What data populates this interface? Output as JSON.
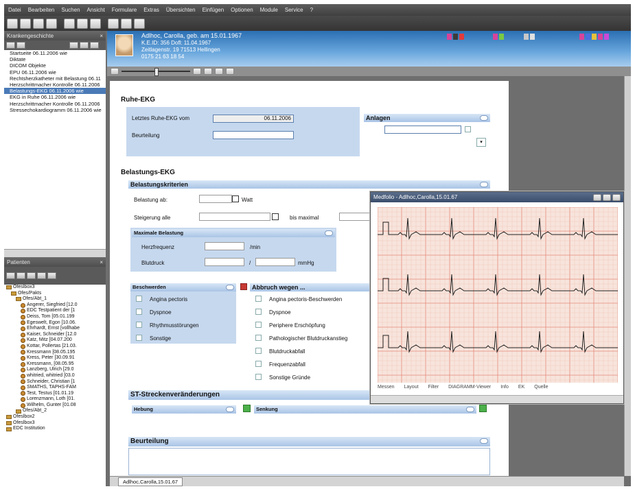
{
  "menu": [
    "Datei",
    "Bearbeiten",
    "Suchen",
    "Ansicht",
    "Formulare",
    "Extras",
    "Übersichten",
    "Einfügen",
    "Optionen",
    "Module",
    "Service",
    "?"
  ],
  "left_top": {
    "title": "Krankengeschichte",
    "items": [
      "Startseite 06.11.2006 wie",
      "Diktate",
      "DICOM Objekte",
      "EPU 06.11.2006 wie",
      "Rechtsherzkatheter mit Belastung 06.11",
      "Herzschrittmacher Kontrolle 06.11.2006",
      "Belastungs-EKG 06.11.2006 wie",
      "EKG in Ruhe 06.11.2006 wie",
      "Herzschrittmacher Kontrolle 06.11.2006",
      "Stressechokardiogramm 06.11.2006 wie"
    ],
    "selected_index": 6
  },
  "left_bottom": {
    "title": "Patienten",
    "tree": [
      {
        "label": "Ofeslbox3",
        "kind": "folder",
        "indent": 0
      },
      {
        "label": "Ofes/Pakts",
        "kind": "folder",
        "indent": 1
      },
      {
        "label": "Ofes/Abt_1",
        "kind": "folder",
        "indent": 2
      },
      {
        "label": "Angerer, Siegfried [12.0",
        "kind": "person",
        "indent": 3
      },
      {
        "label": "EDC Testpatient der [1",
        "kind": "person",
        "indent": 3
      },
      {
        "label": "Deiss, Tom [05.01.199",
        "kind": "person",
        "indent": 3
      },
      {
        "label": "Egeswelt, Egon [10.06.",
        "kind": "person",
        "indent": 3
      },
      {
        "label": "Ehrhardt, Ernst [vollhabe",
        "kind": "person",
        "indent": 3
      },
      {
        "label": "Kaiser, Schneider [12.0",
        "kind": "person",
        "indent": 3
      },
      {
        "label": "Katz, Mitz [04.07.200",
        "kind": "person",
        "indent": 3
      },
      {
        "label": "Kottar, Pollertas [21.03.",
        "kind": "person",
        "indent": 3
      },
      {
        "label": "Kressmann [08.05.195",
        "kind": "person",
        "indent": 3
      },
      {
        "label": "Kress, Peter [30.09.91",
        "kind": "person",
        "indent": 3
      },
      {
        "label": "Kressmann, [08.05.95",
        "kind": "person",
        "indent": 3
      },
      {
        "label": "Lanzberg, Ulrich [29.0",
        "kind": "person",
        "indent": 3
      },
      {
        "label": "whitried, whitried [03.0",
        "kind": "person",
        "indent": 3
      },
      {
        "label": "Schneider, Christian [1",
        "kind": "person",
        "indent": 3
      },
      {
        "label": "SMATHS, TAPHS-FAM",
        "kind": "person",
        "indent": 3
      },
      {
        "label": "Test, Testus [01.01.19",
        "kind": "person",
        "indent": 3
      },
      {
        "label": "Lorenzmann, Loth [01.",
        "kind": "person",
        "indent": 3
      },
      {
        "label": "Wilhelm, Gunter [01.08",
        "kind": "person",
        "indent": 3
      },
      {
        "label": "Ofes/Abt_2",
        "kind": "folder",
        "indent": 2
      },
      {
        "label": "Ofeslbox2",
        "kind": "folder",
        "indent": 0
      },
      {
        "label": "Ofeslbox3",
        "kind": "folder",
        "indent": 0
      },
      {
        "label": "EDC Institution",
        "kind": "folder",
        "indent": 0
      }
    ]
  },
  "patient": {
    "name": "Adlhoc, Carolla, geb. am 15.01.1967",
    "line1": "K.E.ID: 356 Dofl: 11.04.1967",
    "line2": "Zeitlagenstr. 19 71513 Hellingen",
    "line3": "0175 21 63 18 54"
  },
  "swatch_colors": [
    "#d8439a",
    "#3b3b3b",
    "#e23a3a",
    "#d8439a",
    "#7ac943",
    "#c8c8c8",
    "#e0e0e0",
    "#d8439a",
    "#4a6fe0",
    "#e8c23a",
    "#d8439a",
    "#c84ad8"
  ],
  "doc": {
    "ruhe_title": "Ruhe-EKG",
    "letztes_label": "Letztes Ruhe-EKG vom",
    "letztes_value": "06.11.2006",
    "beurteilung_label": "Beurteilung",
    "anlagen": "Anlagen",
    "belastung_title": "Belastungs-EKG",
    "kriterien_bar": "Belastungskriterien",
    "belastung_ab": "Belastung ab:",
    "watt": "Watt",
    "steigerung": "Steigerung alle",
    "bis_maximal": "bis maximal",
    "maximale_bar": "Maximale Belastung",
    "herzfrequenz": "Herzfrequenz",
    "hf_unit": "/min",
    "blutdruck": "Blutdruck",
    "slash": "/",
    "mmhg": "mmHg",
    "beschwerden_bar": "Beschwerden",
    "beschwerden": [
      "Angina pectoris",
      "Dyspnoe",
      "Rhythmusstörungen",
      "Sonstige"
    ],
    "abbruch_bar": "Abbruch wegen ...",
    "abbruch": [
      "Angina pectoris-Beschwerden",
      "Dyspnoe",
      "Periphere Erschöpfung",
      "Pathologischer Blutdruckanstieg",
      "Blutdruckabfall",
      "Frequenzabfall",
      "Sonstige Gründe"
    ],
    "st_title": "ST-Streckenveränderungen",
    "hebung": "Hebung",
    "senkung": "Senkung",
    "beurteilung_bar": "Beurteilung"
  },
  "ecg_window": {
    "title": "Medfolio - Adlhoc,Carolla,15.01.67",
    "footer": [
      "Messen",
      "Layout",
      "Filter",
      "DIAGRAMM-Viewer",
      "Info",
      "EK",
      "Quelle"
    ]
  },
  "bottom_tab": "Adlhoc,Carolla,15.01.67"
}
